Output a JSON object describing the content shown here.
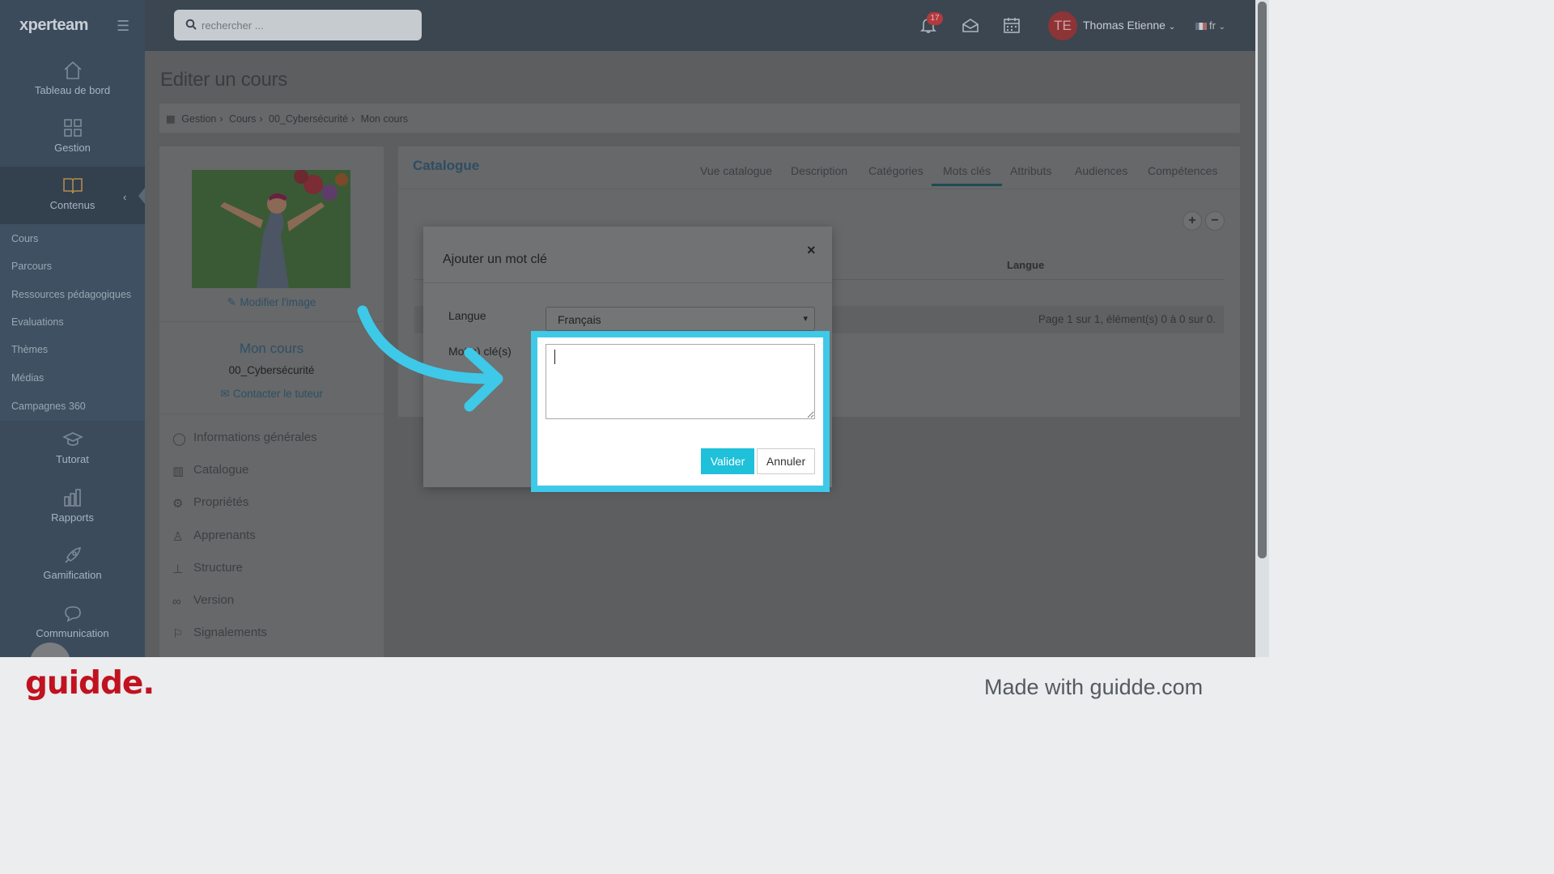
{
  "app": {
    "logo": "xperteam"
  },
  "search": {
    "placeholder": "rechercher ..."
  },
  "topbar": {
    "notifications_count": "17",
    "avatar_initials": "TE",
    "user_name": "Thomas Etienne",
    "language": "fr"
  },
  "sidebar": {
    "items": [
      {
        "label": "Tableau de bord",
        "icon": "home-icon"
      },
      {
        "label": "Gestion",
        "icon": "grid-icon"
      },
      {
        "label": "Contenus",
        "icon": "book-icon"
      },
      {
        "label": "Tutorat",
        "icon": "graduation-cap-icon"
      },
      {
        "label": "Rapports",
        "icon": "bar-chart-icon"
      },
      {
        "label": "Gamification",
        "icon": "rocket-icon"
      },
      {
        "label": "Communication",
        "icon": "chat-icon"
      }
    ],
    "sub_items": [
      "Cours",
      "Parcours",
      "Ressources pédagogiques",
      "Evaluations",
      "Thèmes",
      "Médias",
      "Campagnes 360"
    ]
  },
  "page": {
    "title": "Editer un cours",
    "breadcrumb": [
      "Gestion",
      "Cours",
      "00_Cybersécurité",
      "Mon cours"
    ]
  },
  "course": {
    "modify_image": "Modifier l'image",
    "name": "Mon cours",
    "category": "00_Cybersécurité",
    "contact_tutor": "Contacter le tuteur",
    "menu": [
      {
        "label": "Informations générales",
        "icon": "speech-bubble-icon"
      },
      {
        "label": "Catalogue",
        "icon": "book-icon"
      },
      {
        "label": "Propriétés",
        "icon": "gear-icon"
      },
      {
        "label": "Apprenants",
        "icon": "users-icon"
      },
      {
        "label": "Structure",
        "icon": "sitemap-icon"
      },
      {
        "label": "Version",
        "icon": "link-icon"
      },
      {
        "label": "Signalements",
        "icon": "flag-icon"
      }
    ]
  },
  "catalogue": {
    "title": "Catalogue",
    "tabs": [
      "Vue catalogue",
      "Description",
      "Catégories",
      "Mots clés",
      "Attributs",
      "Audiences",
      "Compétences"
    ],
    "active_tab": "Mots clés",
    "column_langue": "Langue",
    "pager": "Page 1 sur 1, élément(s) 0 à 0 sur 0."
  },
  "modal": {
    "title": "Ajouter un mot clé",
    "langue_label": "Langue",
    "langue_value": "Français",
    "keywords_label": "Mot(s) clé(s)",
    "keywords_value": "",
    "validate": "Valider",
    "cancel": "Annuler"
  },
  "footer": {
    "brand": "guidde.",
    "made_with": "Made with guidde.com"
  },
  "colors": {
    "highlight": "#3ec9e8",
    "validate_button": "#1fc0d9",
    "brand_red": "#c1121f"
  }
}
